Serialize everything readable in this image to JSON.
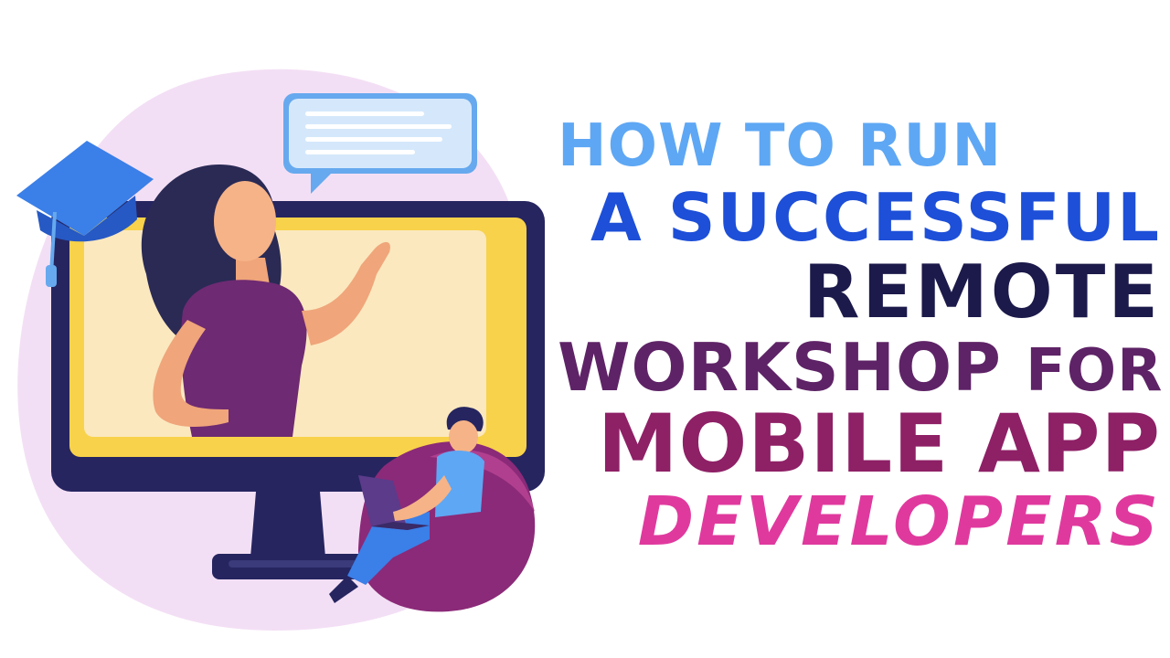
{
  "headline": {
    "line1": "HOW TO RUN",
    "line2": "A SUCCESSFUL",
    "line3": "REMOTE",
    "line4_main": "WORKSHOP",
    "line4_small": "FOR",
    "line5": "MOBILE APP",
    "line6": "DEVELOPERS"
  },
  "colors": {
    "line1": "#5ea7f4",
    "line2": "#1d4fd8",
    "line3": "#1c1a4a",
    "line4": "#5e2366",
    "line5": "#8e2066",
    "line6": "#e0399e",
    "blob": "#f3dff5",
    "monitor_frame": "#262560",
    "screen": "#f8d24a",
    "speech_bubble": "#b8d8f8"
  },
  "illustration": {
    "icons": [
      "graduation-cap-icon",
      "speech-bubble-icon",
      "monitor-icon",
      "laptop-icon",
      "bean-bag-icon"
    ]
  }
}
